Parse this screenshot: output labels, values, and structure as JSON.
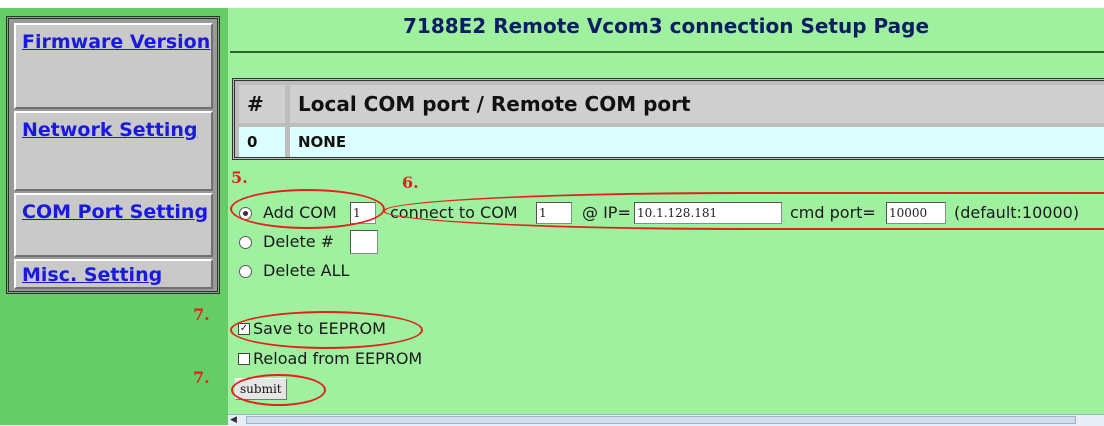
{
  "header_fragment": "",
  "sidebar": {
    "items": [
      {
        "label": "Firmware Version"
      },
      {
        "label": "Network Setting"
      },
      {
        "label": "COM Port Setting"
      },
      {
        "label": "Misc. Setting"
      }
    ]
  },
  "page": {
    "title": "7188E2 Remote Vcom3 connection Setup Page"
  },
  "table": {
    "headers": [
      "#",
      "Local COM port / Remote COM port"
    ],
    "rows": [
      [
        "0",
        "NONE"
      ]
    ]
  },
  "form": {
    "add_com": {
      "label": "Add COM",
      "value": "1",
      "selected": true
    },
    "connect_label": "connect to COM",
    "connect_com_value": "1",
    "ip_label": "@ IP=",
    "ip_value": "10.1.128.181",
    "cmd_port_label": "cmd port=",
    "cmd_port_value": "10000",
    "default_note": "(default:10000)",
    "delete": {
      "label": "Delete #",
      "value": ""
    },
    "delete_all": {
      "label": "Delete ALL"
    },
    "save_eeprom": {
      "label": "Save to EEPROM",
      "checked": true
    },
    "reload_eeprom": {
      "label": "Reload from EEPROM",
      "checked": false
    },
    "submit_label": "submit"
  },
  "annotations": {
    "step5": "5.",
    "step6": "6.",
    "step7a": "7.",
    "step7b": "7."
  },
  "colors": {
    "sidebar_bg": "#66cc66",
    "main_bg": "#9ff09f",
    "link": "#1a1adf",
    "annotation_red": "#e2211c"
  }
}
